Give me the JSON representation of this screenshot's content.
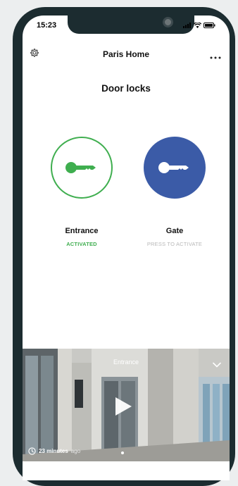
{
  "status_bar": {
    "time": "15:23"
  },
  "header": {
    "title": "Paris Home"
  },
  "section": {
    "title": "Door locks"
  },
  "locks": [
    {
      "name": "Entrance",
      "state": "ACTIVATED"
    },
    {
      "name": "Gate",
      "state": "PRESS TO ACTIVATE"
    }
  ],
  "camera": {
    "label": "Entrance",
    "time_bold": "23 minutes",
    "time_rest": "ago"
  },
  "colors": {
    "activated_green": "#3fae4f",
    "gate_blue": "#3b5ba7",
    "phone_frame": "#1c2c30"
  },
  "icons": [
    "gear-icon",
    "more-icon",
    "key-icon",
    "chevron-down-icon",
    "play-icon",
    "clock-icon"
  ]
}
